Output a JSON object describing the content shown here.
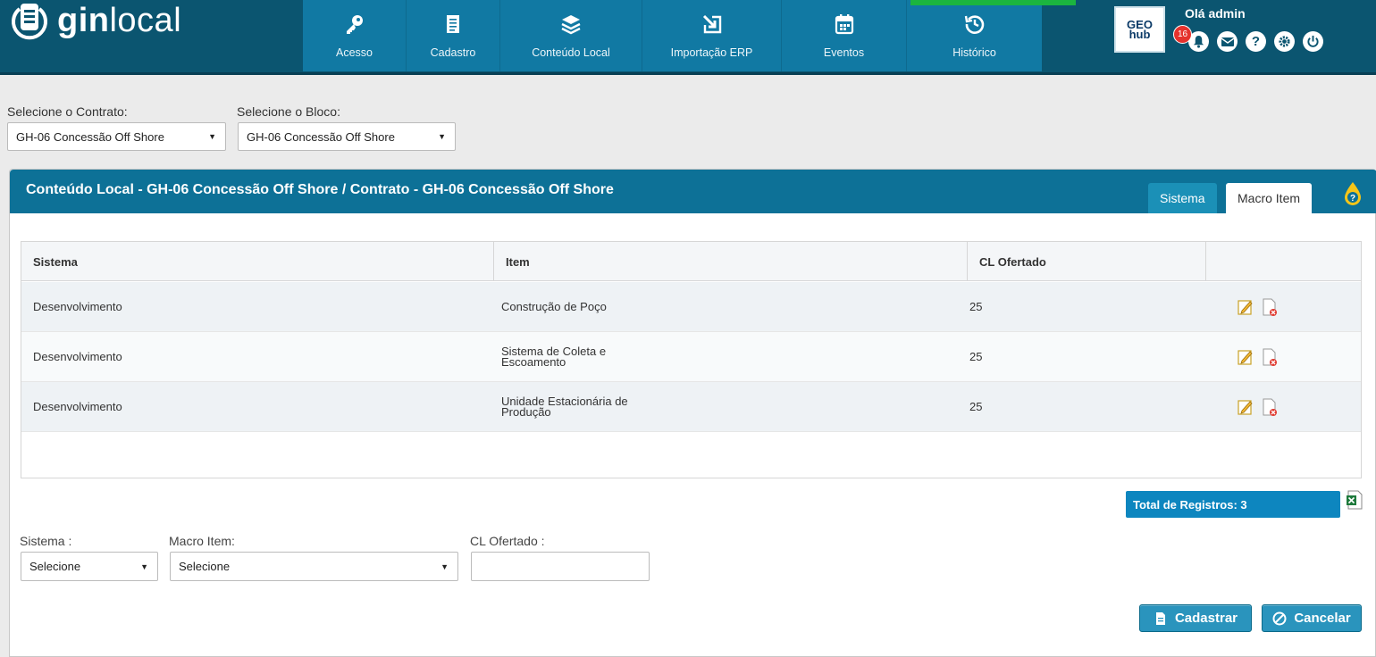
{
  "brand": {
    "name_bold": "gin",
    "name_light": "local"
  },
  "nav": {
    "items": [
      {
        "label": "Acesso",
        "icon": "key-icon"
      },
      {
        "label": "Cadastro",
        "icon": "document-icon"
      },
      {
        "label": "Conteúdo Local",
        "icon": "layers-icon"
      },
      {
        "label": "Importação ERP",
        "icon": "import-icon"
      },
      {
        "label": "Eventos",
        "icon": "calendar-icon"
      },
      {
        "label": "Histórico",
        "icon": "history-icon"
      }
    ],
    "active_label": "Importação ERP"
  },
  "header": {
    "greeting": "Olá admin",
    "notifications_count": "16",
    "partner_logo": "GEO hub",
    "icons": [
      "bell-icon",
      "mail-icon",
      "help-icon",
      "gear-icon",
      "power-icon"
    ]
  },
  "filters": {
    "contract_label": "Selecione o Contrato:",
    "contract_value": "GH-06 Concessão Off Shore",
    "block_label": "Selecione o Bloco:",
    "block_value": "GH-06 Concessão Off Shore"
  },
  "panel": {
    "title": "Conteúdo Local - GH-06 Concessão Off Shore / Contrato - GH-06 Concessão Off Shore",
    "tabs": [
      {
        "label": "Sistema",
        "active": false
      },
      {
        "label": "Macro Item",
        "active": true
      }
    ]
  },
  "table": {
    "columns": [
      "Sistema",
      "Item",
      "CL Ofertado",
      ""
    ],
    "rows": [
      {
        "sistema": "Desenvolvimento",
        "item": "Construção de Poço",
        "cl": "25"
      },
      {
        "sistema": "Desenvolvimento",
        "item": "Sistema de Coleta e Escoamento",
        "cl": "25"
      },
      {
        "sistema": "Desenvolvimento",
        "item": "Unidade Estacionária de Produção",
        "cl": "25"
      }
    ],
    "total_label": "Total de Registros: 3"
  },
  "form": {
    "sistema_label": "Sistema :",
    "sistema_value": "Selecione",
    "macro_label": "Macro Item:",
    "macro_value": "Selecione",
    "cl_label": "CL Ofertado :",
    "cl_value": ""
  },
  "actions": {
    "save_label": "Cadastrar",
    "cancel_label": "Cancelar"
  },
  "colors": {
    "topbar": "#0b5570",
    "nav": "#1179a3",
    "panel_header": "#0d7197",
    "active_indicator": "#1bb53f",
    "badge": "#e5322d"
  }
}
